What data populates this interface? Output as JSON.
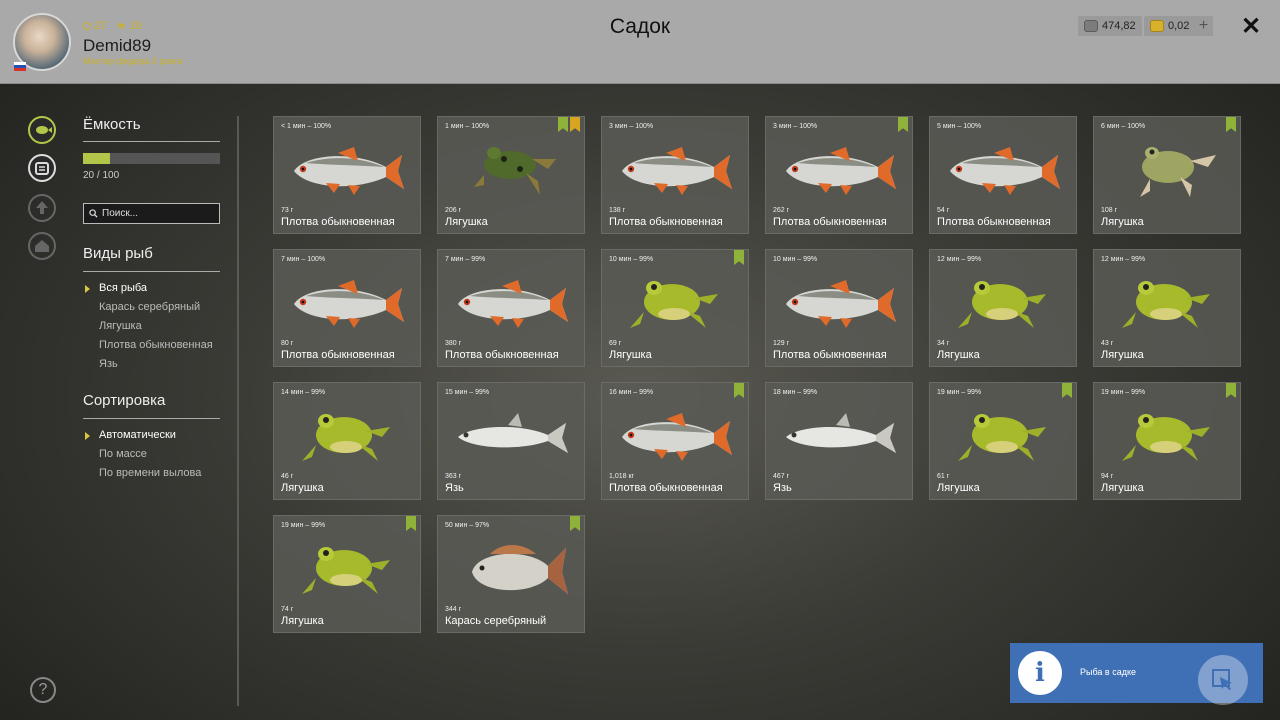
{
  "header": {
    "title": "Садок",
    "username": "Demid89",
    "rank": "Мастер фидера 2 ранга",
    "level": "27",
    "stars": "19",
    "silver": "474,82",
    "gold": "0,02",
    "plus": "+",
    "close": "✕"
  },
  "capacity": {
    "title": "Ёмкость",
    "value": "20 / 100",
    "fraction": 0.2
  },
  "search": {
    "placeholder": "Поиск..."
  },
  "species": {
    "title": "Виды рыб",
    "items": [
      "Вся рыба",
      "Карась серебряный",
      "Лягушка",
      "Плотва обыкновенная",
      "Язь"
    ]
  },
  "sorting": {
    "title": "Сортировка",
    "items": [
      "Автоматически",
      "По массе",
      "По времени вылова"
    ]
  },
  "fish": [
    {
      "time": "< 1 мин – 100%",
      "weight": "73 г",
      "name": "Плотва обыкновенная",
      "kind": "roach",
      "badges": []
    },
    {
      "time": "1 мин – 100%",
      "weight": "206 г",
      "name": "Лягушка",
      "kind": "frog-dark",
      "badges": [
        "green",
        "gold"
      ]
    },
    {
      "time": "3 мин – 100%",
      "weight": "138 г",
      "name": "Плотва обыкновенная",
      "kind": "roach",
      "badges": []
    },
    {
      "time": "3 мин – 100%",
      "weight": "262 г",
      "name": "Плотва обыкновенная",
      "kind": "roach",
      "badges": [
        "green"
      ]
    },
    {
      "time": "5 мин – 100%",
      "weight": "54 г",
      "name": "Плотва обыкновенная",
      "kind": "roach",
      "badges": []
    },
    {
      "time": "6 мин – 100%",
      "weight": "108 г",
      "name": "Лягушка",
      "kind": "frog-pale",
      "badges": [
        "green"
      ]
    },
    {
      "time": "7 мин – 100%",
      "weight": "80 г",
      "name": "Плотва обыкновенная",
      "kind": "roach",
      "badges": []
    },
    {
      "time": "7 мин – 99%",
      "weight": "380 г",
      "name": "Плотва обыкновенная",
      "kind": "roach",
      "badges": []
    },
    {
      "time": "10 мин – 99%",
      "weight": "69 г",
      "name": "Лягушка",
      "kind": "frog",
      "badges": [
        "green"
      ]
    },
    {
      "time": "10 мин – 99%",
      "weight": "129 г",
      "name": "Плотва обыкновенная",
      "kind": "roach",
      "badges": []
    },
    {
      "time": "12 мин – 99%",
      "weight": "34 г",
      "name": "Лягушка",
      "kind": "frog",
      "badges": []
    },
    {
      "time": "12 мин – 99%",
      "weight": "43 г",
      "name": "Лягушка",
      "kind": "frog",
      "badges": []
    },
    {
      "time": "14 мин – 99%",
      "weight": "46 г",
      "name": "Лягушка",
      "kind": "frog",
      "badges": []
    },
    {
      "time": "15 мин – 99%",
      "weight": "363 г",
      "name": "Язь",
      "kind": "ide",
      "badges": []
    },
    {
      "time": "16 мин – 99%",
      "weight": "1,018 кг",
      "name": "Плотва обыкновенная",
      "kind": "roach",
      "badges": [
        "green"
      ]
    },
    {
      "time": "18 мин – 99%",
      "weight": "467 г",
      "name": "Язь",
      "kind": "ide",
      "badges": []
    },
    {
      "time": "19 мин – 99%",
      "weight": "61 г",
      "name": "Лягушка",
      "kind": "frog",
      "badges": [
        "green"
      ]
    },
    {
      "time": "19 мин – 99%",
      "weight": "94 г",
      "name": "Лягушка",
      "kind": "frog",
      "badges": [
        "green"
      ]
    },
    {
      "time": "19 мин – 99%",
      "weight": "74 г",
      "name": "Лягушка",
      "kind": "frog",
      "badges": [
        "green"
      ]
    },
    {
      "time": "50 мин – 97%",
      "weight": "344 г",
      "name": "Карась серебряный",
      "kind": "crucian",
      "badges": [
        "green"
      ]
    }
  ],
  "toast": {
    "text": "Рыба в садке",
    "icon": "i"
  },
  "help": "?"
}
